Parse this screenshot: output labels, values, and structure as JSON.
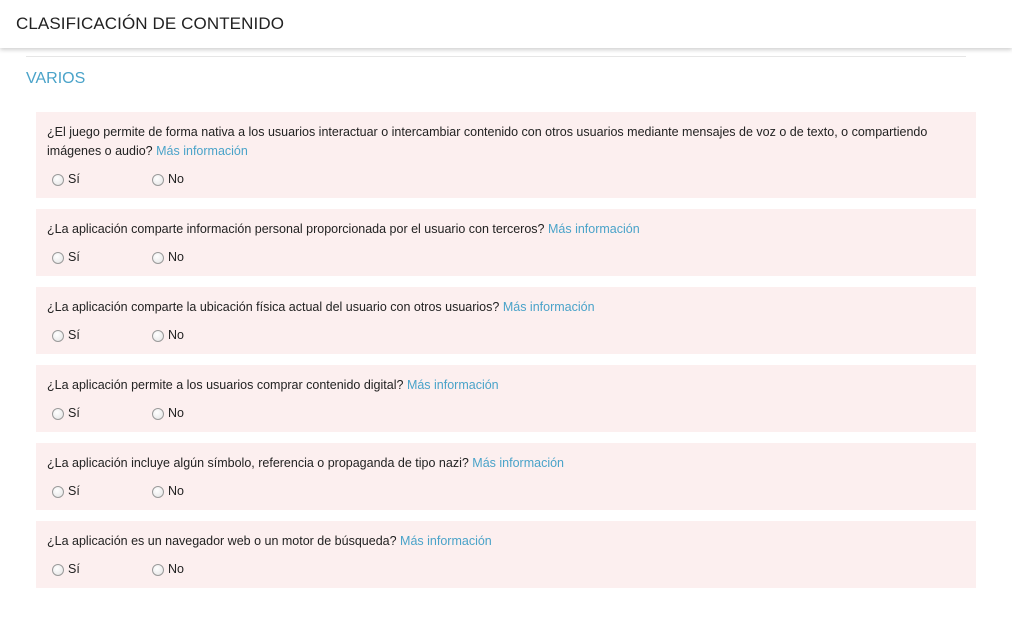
{
  "header": {
    "title": "CLASIFICACIÓN DE CONTENIDO"
  },
  "section": {
    "title": "VARIOS"
  },
  "more_info": "Más información",
  "options": {
    "yes": "Sí",
    "no": "No"
  },
  "questions": [
    {
      "text": "¿El juego permite de forma nativa a los usuarios interactuar o intercambiar contenido con otros usuarios mediante mensajes de voz o de texto, o compartiendo imágenes o audio?"
    },
    {
      "text": "¿La aplicación comparte información personal proporcionada por el usuario con terceros?"
    },
    {
      "text": "¿La aplicación comparte la ubicación física actual del usuario con otros usuarios?"
    },
    {
      "text": "¿La aplicación permite a los usuarios comprar contenido digital?"
    },
    {
      "text": "¿La aplicación incluye algún símbolo, referencia o propaganda de tipo nazi?"
    },
    {
      "text": "¿La aplicación es un navegador web o un motor de búsqueda?"
    }
  ],
  "colors": {
    "accent": "#4aa3c9",
    "question_bg": "#fcefef"
  }
}
